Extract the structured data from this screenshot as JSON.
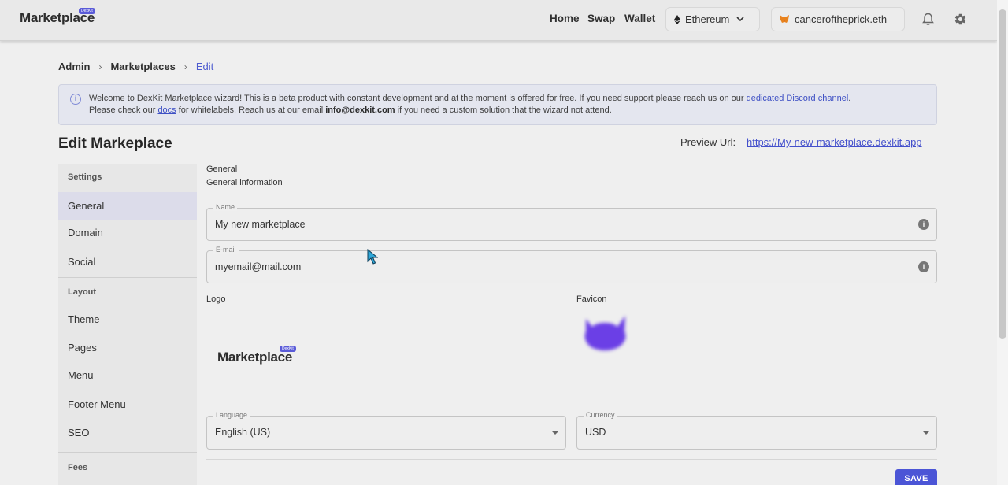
{
  "header": {
    "brand": "Marketplace",
    "brand_badge": "DexKit",
    "nav": [
      "Home",
      "Swap",
      "Wallet"
    ],
    "network": "Ethereum",
    "account": "canceroftheprick.eth"
  },
  "breadcrumb": [
    "Admin",
    "Marketplaces",
    "Edit"
  ],
  "banner": {
    "text_1": "Welcome to DexKit Marketplace wizard! This is a beta product with constant development and at the moment is offered for free. If you need support please reach us on our ",
    "discord_link": "dedicated Discord channel",
    "text_2": ".",
    "text_3": "Please check our ",
    "docs_link": "docs",
    "text_4": " for whitelabels. Reach us at our email ",
    "email": "info@dexkit.com",
    "text_5": " if you need a custom solution that the wizard not attend."
  },
  "page": {
    "title": "Edit Markeplace",
    "preview_label": "Preview Url:",
    "preview_url": "https://My-new-marketplace.dexkit.app"
  },
  "sidebar": {
    "settings_header": "Settings",
    "settings_items": [
      "General",
      "Domain",
      "Social"
    ],
    "layout_header": "Layout",
    "layout_items": [
      "Theme",
      "Pages",
      "Menu",
      "Footer Menu",
      "SEO"
    ],
    "fees_header": "Fees",
    "selected": "General"
  },
  "form": {
    "section_title": "General",
    "section_sub": "General information",
    "name_label": "Name",
    "name_value": "My new marketplace",
    "email_label": "E-mail",
    "email_value": "myemail@mail.com",
    "logo_label": "Logo",
    "logo_text": "Marketplace",
    "logo_badge": "DexKit",
    "favicon_label": "Favicon",
    "language_label": "Language",
    "language_value": "English (US)",
    "currency_label": "Currency",
    "currency_value": "USD",
    "save_label": "SAVE"
  },
  "colors": {
    "accent": "#4b55d6",
    "favicon": "#6b3fe6",
    "link": "#4450cc"
  },
  "icons": [
    "ethereum-icon",
    "chevron-down-icon",
    "metamask-icon",
    "bell-icon",
    "gear-icon",
    "info-circle-icon",
    "info-icon",
    "caret-down-icon",
    "cursor-icon"
  ]
}
